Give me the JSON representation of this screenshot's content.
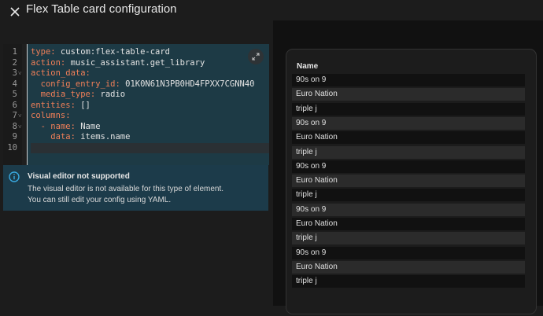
{
  "header": {
    "title": "Flex Table card configuration"
  },
  "editor": {
    "lines": [
      {
        "n": "1",
        "fold": "",
        "indent": "",
        "key": "type:",
        "value": " custom:flex-table-card"
      },
      {
        "n": "2",
        "fold": "",
        "indent": "",
        "key": "action:",
        "value": " music_assistant.get_library"
      },
      {
        "n": "3",
        "fold": "˅",
        "indent": "",
        "key": "action_data:",
        "value": ""
      },
      {
        "n": "4",
        "fold": "",
        "indent": "  ",
        "key": "config_entry_id:",
        "value": " 01K0N61N3PB0HD4FPXX7CGNN40"
      },
      {
        "n": "5",
        "fold": "",
        "indent": "  ",
        "key": "media_type:",
        "value": " radio"
      },
      {
        "n": "6",
        "fold": "",
        "indent": "",
        "key": "entities:",
        "value": " []"
      },
      {
        "n": "7",
        "fold": "˅",
        "indent": "",
        "key": "columns:",
        "value": ""
      },
      {
        "n": "8",
        "fold": "˅",
        "indent": "  - ",
        "key": "name:",
        "value": " Name"
      },
      {
        "n": "9",
        "fold": "",
        "indent": "    ",
        "key": "data:",
        "value": " items.name"
      },
      {
        "n": "10",
        "fold": "",
        "indent": "",
        "key": "",
        "value": ""
      }
    ]
  },
  "alert": {
    "title": "Visual editor not supported",
    "line1": "The visual editor is not available for this type of element.",
    "line2": "You can still edit your config using YAML."
  },
  "table": {
    "column_header": "Name",
    "rows": [
      "90s on 9",
      "Euro Nation",
      "triple j",
      "90s on 9",
      "Euro Nation",
      "triple j",
      "90s on 9",
      "Euro Nation",
      "triple j",
      "90s on 9",
      "Euro Nation",
      "triple j",
      "90s on 9",
      "Euro Nation",
      "triple j"
    ]
  },
  "colors": {
    "key": "#f07f58",
    "editor_bg": "#1d3a45",
    "alert_bg": "#1c3b4a",
    "alert_icon": "#39a9e0"
  },
  "icons": {
    "close": "close-icon",
    "expand": "expand-icon",
    "info": "info-icon"
  }
}
